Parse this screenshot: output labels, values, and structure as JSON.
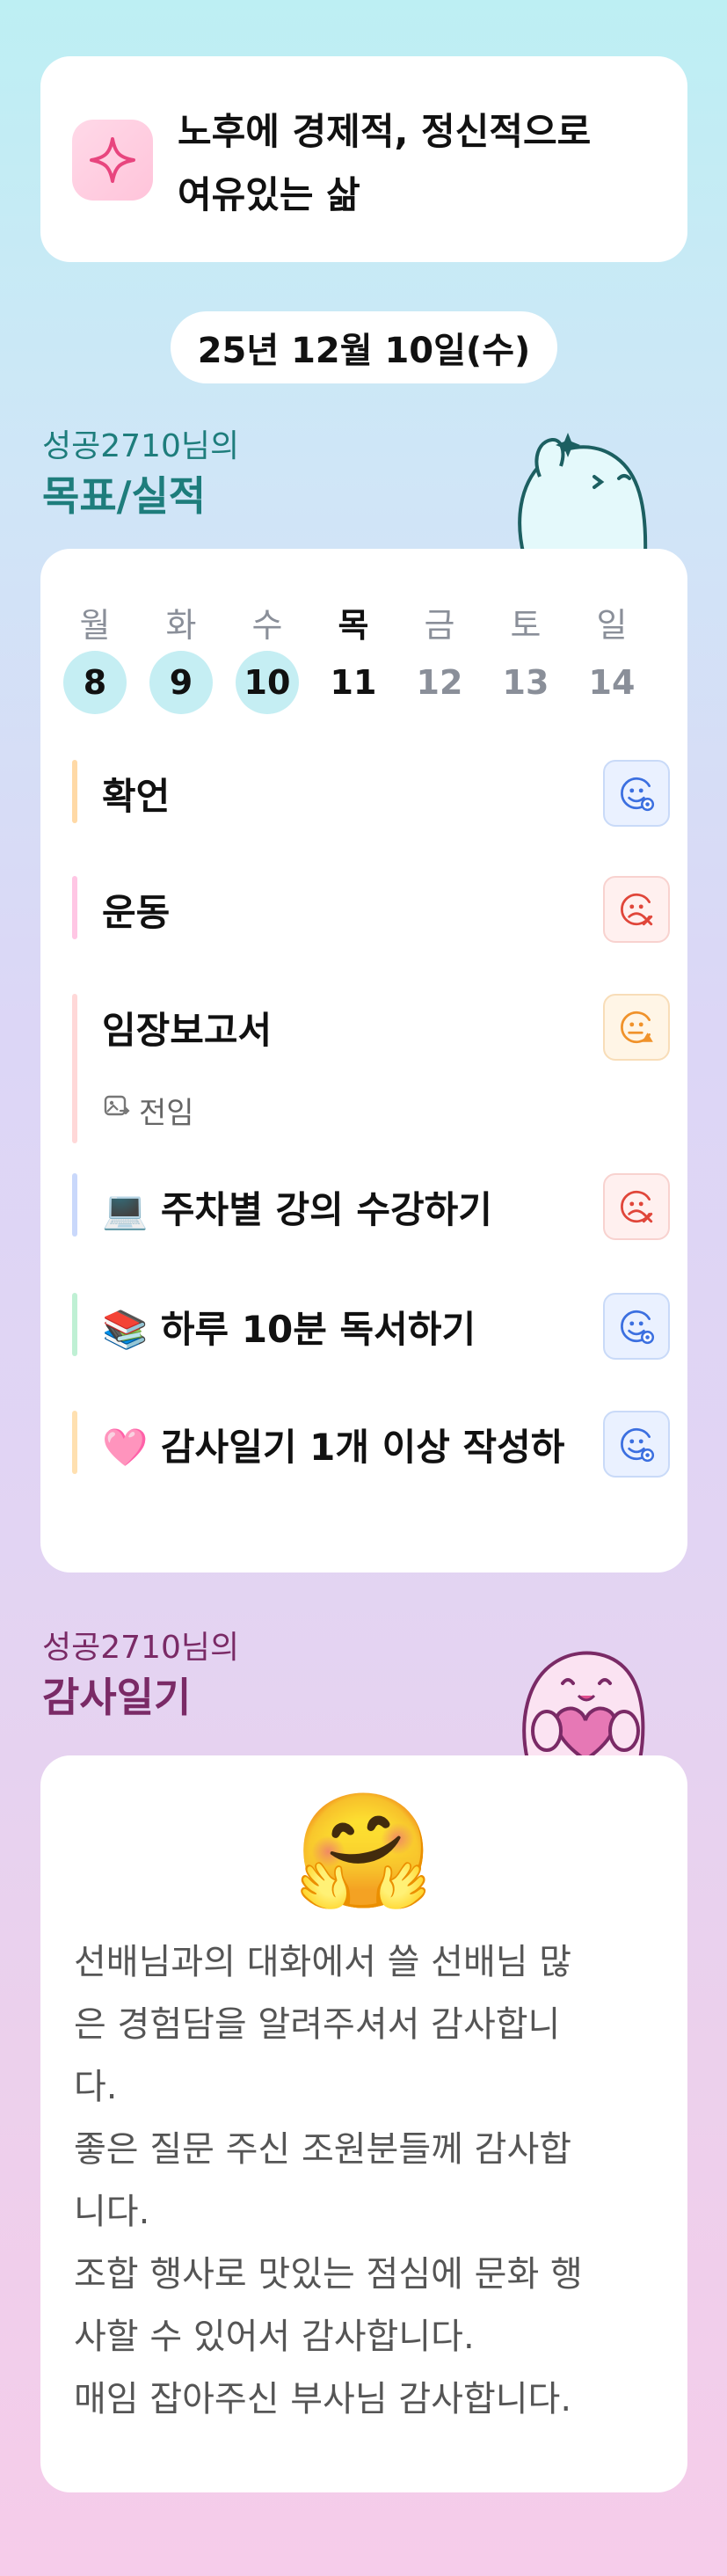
{
  "motto": {
    "icon": "sparkle-icon",
    "text": "노후에 경제적, 정신적으로\n여유있는 삶"
  },
  "date": "25년 12월 10일(수)",
  "goals_section": {
    "user": "성공2710님의",
    "title": "목표/실적"
  },
  "week": {
    "days": [
      "월",
      "화",
      "수",
      "목",
      "금",
      "토",
      "일"
    ],
    "dates": [
      "8",
      "9",
      "10",
      "11",
      "12",
      "13",
      "14"
    ],
    "completed": [
      true,
      true,
      true,
      false,
      false,
      false,
      false
    ],
    "today_index": 3
  },
  "goals": [
    {
      "label": "확언",
      "status": "done",
      "status_icon": "smile-check-icon",
      "bar_color": "#ffd9a6"
    },
    {
      "label": "운동",
      "status": "fail",
      "status_icon": "frown-x-icon",
      "bar_color": "#ffc6e4"
    },
    {
      "label": "임장보고서",
      "status": "partial",
      "status_icon": "meh-warning-icon",
      "bar_color": "#ffd8d8",
      "note": "전임",
      "note_icon": "share-image-icon"
    },
    {
      "label": "💻 주차별 강의 수강하기",
      "status": "fail",
      "status_icon": "frown-x-icon",
      "bar_color": "#c9d8fb"
    },
    {
      "label": "📚 하루 10분 독서하기",
      "status": "done",
      "status_icon": "smile-check-icon",
      "bar_color": "#bff0d4"
    },
    {
      "label": "🩷 감사일기 1개 이상 작성하",
      "status": "done",
      "status_icon": "smile-check-icon",
      "bar_color": "#ffe0b0"
    }
  ],
  "gratitude_section": {
    "user": "성공2710님의",
    "title": "감사일기"
  },
  "gratitude": {
    "emoji": "🤗",
    "text": "선배님과의 대화에서 쓸 선배님 많\n은 경험담을 알려주셔서 감사합니\n다.\n좋은 질문 주신 조원분들께 감사합\n니다.\n조합 행사로 맛있는 점심에 문화 행\n사할 수 있어서 감사합니다.\n매임 잡아주신 부사님 감사합니다."
  },
  "colors": {
    "accent_teal": "#1e7d7c",
    "accent_purple": "#7a2a66",
    "done": "#3b6fe0",
    "fail": "#e0463a",
    "partial": "#f0922b",
    "today_circle": "#c5eef3"
  }
}
